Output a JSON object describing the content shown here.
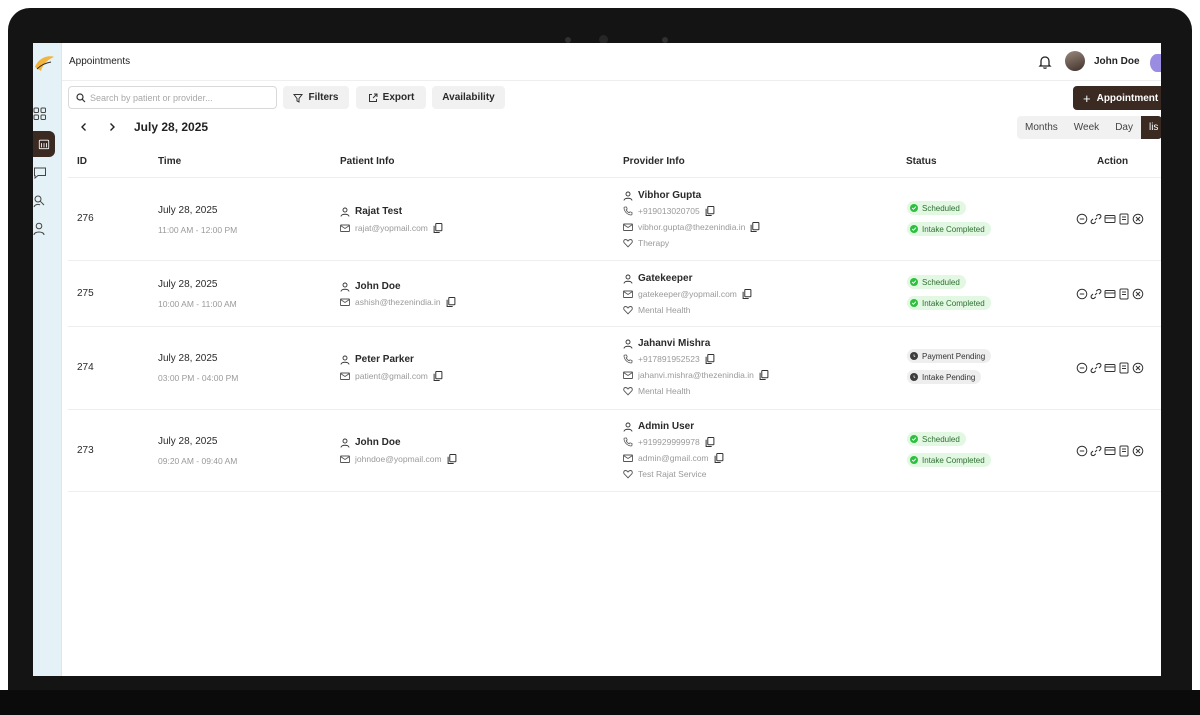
{
  "header": {
    "title": "Appointments",
    "user_name": "John Doe"
  },
  "toolbar": {
    "search_placeholder": "Search by patient or provider...",
    "filters_label": "Filters",
    "export_label": "Export",
    "availability_label": "Availability",
    "new_label": "Appointment"
  },
  "date_nav": {
    "current_date": "July 28, 2025"
  },
  "views": {
    "months": "Months",
    "week": "Week",
    "day": "Day",
    "list": "lis"
  },
  "table": {
    "headers": {
      "id": "ID",
      "time": "Time",
      "patient": "Patient Info",
      "provider": "Provider Info",
      "status": "Status",
      "action": "Action"
    },
    "rows": [
      {
        "id": "276",
        "date": "July 28, 2025",
        "time_range": "11:00 AM - 12:00 PM",
        "patient_name": "Rajat Test",
        "patient_email": "rajat@yopmail.com",
        "provider_name": "Vibhor Gupta",
        "provider_phone": "+919013020705",
        "provider_email": "vibhor.gupta@thezenindia.in",
        "service": "Therapy",
        "status1": "Scheduled",
        "status2": "Intake Completed"
      },
      {
        "id": "275",
        "date": "July 28, 2025",
        "time_range": "10:00 AM - 11:00 AM",
        "patient_name": "John Doe",
        "patient_email": "ashish@thezenindia.in",
        "provider_name": "Gatekeeper",
        "provider_email": "gatekeeper@yopmail.com",
        "service": "Mental Health",
        "status1": "Scheduled",
        "status2": "Intake Completed"
      },
      {
        "id": "274",
        "date": "July 28, 2025",
        "time_range": "03:00 PM - 04:00 PM",
        "patient_name": "Peter Parker",
        "patient_email": "patient@gmail.com",
        "provider_name": "Jahanvi Mishra",
        "provider_phone": "+917891952523",
        "provider_email": "jahanvi.mishra@thezenindia.in",
        "service": "Mental Health",
        "status1": "Payment Pending",
        "status2": "Intake Pending"
      },
      {
        "id": "273",
        "date": "July 28, 2025",
        "time_range": "09:20 AM - 09:40 AM",
        "patient_name": "John Doe",
        "patient_email": "johndoe@yopmail.com",
        "provider_name": "Admin User",
        "provider_phone": "+919929999978",
        "provider_email": "admin@gmail.com",
        "service": "Test Rajat Service",
        "status1": "Scheduled",
        "status2": "Intake Completed"
      }
    ]
  },
  "colors": {
    "accent": "#3a2a22",
    "success_bg": "#e2f8e2",
    "success_dot": "#2dbf3e",
    "pending_bg": "#eeeeee",
    "sidebar_bg": "#e4f1f7"
  },
  "icons": [
    "bell-icon",
    "search-icon",
    "filter-icon",
    "export-icon",
    "plus-icon",
    "chevron-left-icon",
    "chevron-right-icon",
    "user-icon",
    "mail-icon",
    "phone-icon",
    "heart-icon",
    "copy-icon",
    "message-icon",
    "link-icon",
    "card-icon",
    "document-icon",
    "cancel-icon"
  ]
}
